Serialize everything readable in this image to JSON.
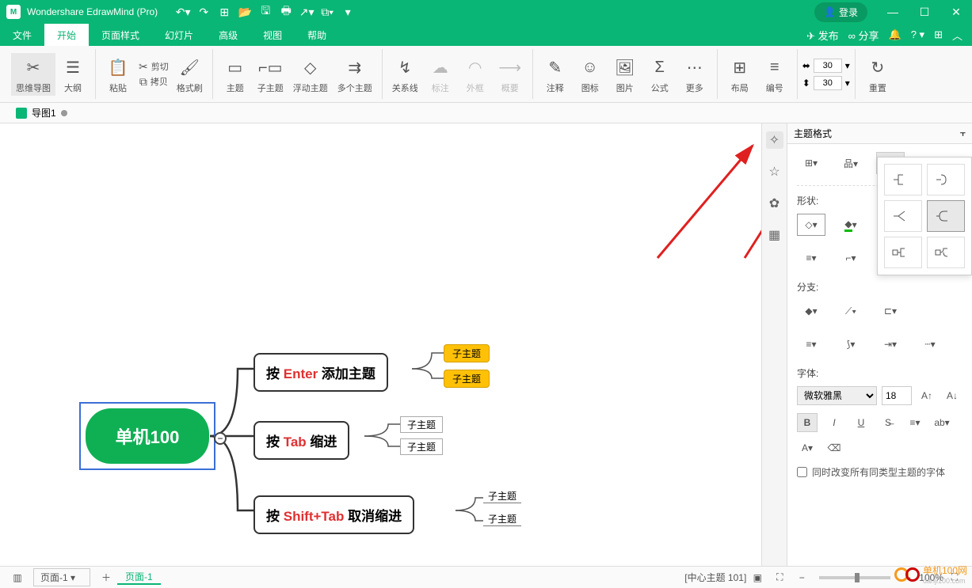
{
  "app": {
    "title": "Wondershare EdrawMind (Pro)",
    "login": "登录"
  },
  "menu": {
    "items": [
      "文件",
      "开始",
      "页面样式",
      "幻灯片",
      "高级",
      "视图",
      "帮助"
    ],
    "activeIndex": 1,
    "publish": "发布",
    "share": "分享"
  },
  "ribbon": {
    "mindmap": "思维导图",
    "outline": "大纲",
    "paste": "粘贴",
    "cut": "剪切",
    "copy": "拷贝",
    "brush": "格式刷",
    "topic": "主题",
    "subtopic": "子主题",
    "floating": "浮动主题",
    "multi": "多个主题",
    "relation": "关系线",
    "callout": "标注",
    "boundary": "外框",
    "summary": "概要",
    "note": "注释",
    "icon": "图标",
    "picture": "图片",
    "formula": "公式",
    "more": "更多",
    "layout": "布局",
    "number": "编号",
    "w": "30",
    "h": "30",
    "reset": "重置"
  },
  "doctab": {
    "label": "导图1"
  },
  "panel": {
    "title": "主题格式",
    "shape": "形状:",
    "branch": "分支:",
    "font": "字体:",
    "fontname": "微软雅黑",
    "fontsize": "18",
    "checkbox": "同时改变所有同类型主题的字体"
  },
  "mindmap": {
    "center": "单机100",
    "n1_pre": "按 ",
    "n1_key": "Enter",
    "n1_post": " 添加主题",
    "n2_pre": "按 ",
    "n2_key": "Tab",
    "n2_post": " 缩进",
    "n3_pre": "按 ",
    "n3_key": "Shift+Tab",
    "n3_post": " 取消缩进",
    "sub": "子主题"
  },
  "status": {
    "pageSelect": "页面-1",
    "pageTab": "页面-1",
    "info": "[中心主题 101]",
    "zoom": "100%"
  },
  "watermark": {
    "text": "单机100网",
    "url": "danji100.com"
  }
}
